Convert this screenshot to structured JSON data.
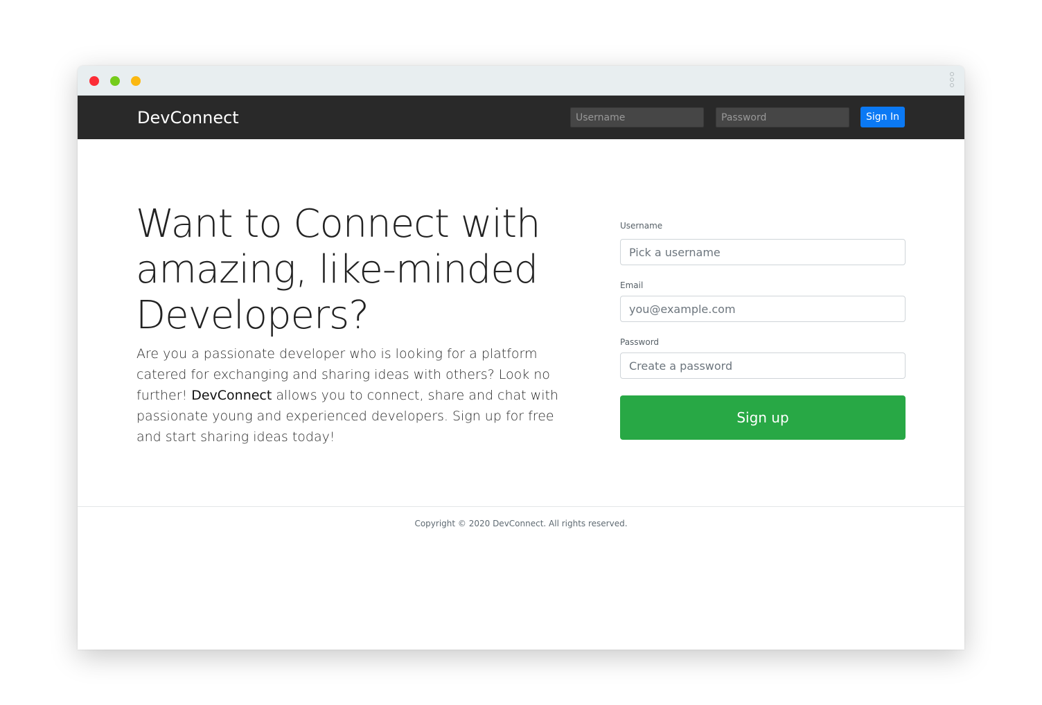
{
  "navbar": {
    "brand": "DevConnect",
    "username_placeholder": "Username",
    "password_placeholder": "Password",
    "signin_label": "Sign In"
  },
  "hero": {
    "title": "Want to Connect with amazing, like-minded Developers?",
    "text_before": "Are you a passionate developer who is looking for a platform catered for exchanging and sharing ideas with others? Look no further! ",
    "text_brand": "DevConnect",
    "text_after": " allows you to connect, share and chat with passionate young and experienced developers. Sign up for free and start sharing ideas today!"
  },
  "signup_form": {
    "username_label": "Username",
    "username_placeholder": "Pick a username",
    "email_label": "Email",
    "email_placeholder": "you@example.com",
    "password_label": "Password",
    "password_placeholder": "Create a password",
    "submit_label": "Sign up"
  },
  "footer": {
    "copyright": "Copyright © 2020 DevConnect. All rights reserved."
  },
  "colors": {
    "navbar_bg": "#292929",
    "signin_blue": "#0b79f4",
    "signup_green": "#28a845"
  }
}
